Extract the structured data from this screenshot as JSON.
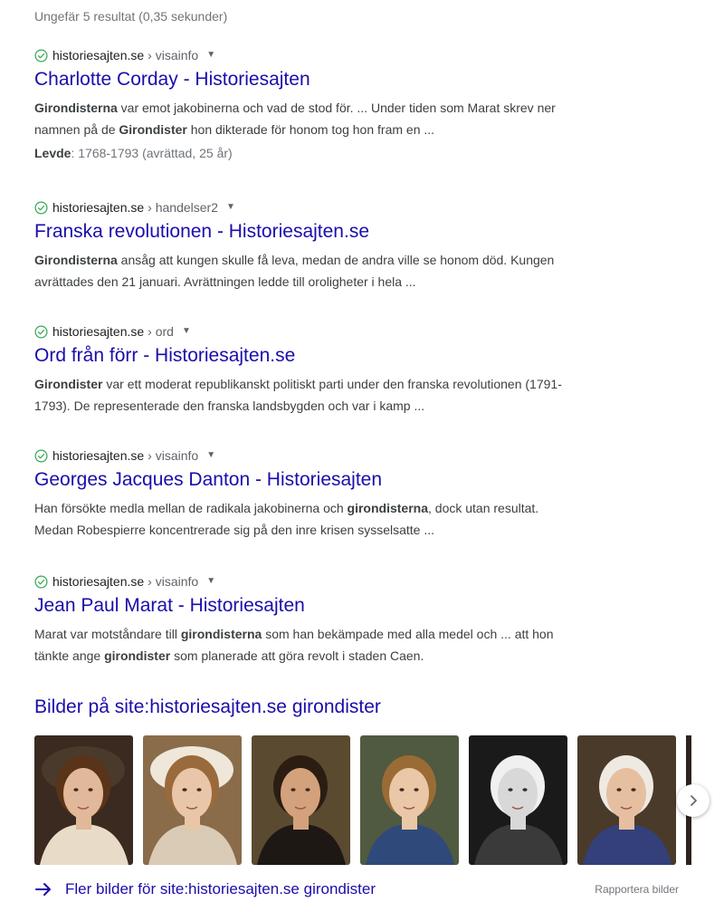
{
  "stats": "Ungefär 5 resultat (0,35 sekunder)",
  "results": [
    {
      "domain": "historiesajten.se",
      "path": "› visainfo",
      "title": "Charlotte Corday - Historiesajten",
      "snippet": [
        [
          {
            "b": "Girondisterna"
          },
          {
            "t": " var emot jakobinerna och vad de stod för. ... Under tiden som Marat skrev ner"
          }
        ],
        [
          {
            "t": "namnen på de "
          },
          {
            "b": "Girondister"
          },
          {
            "t": " hon dikterade för honom tog hon fram en ..."
          }
        ]
      ],
      "extra_label": "Levde",
      "extra_value": ": 1768-1793 (avrättad, 25 år)"
    },
    {
      "domain": "historiesajten.se",
      "path": "› handelser2",
      "title": "Franska revolutionen - Historiesajten.se",
      "snippet": [
        [
          {
            "b": "Girondisterna"
          },
          {
            "t": " ansåg att kungen skulle få leva, medan de andra ville se honom död. Kungen"
          }
        ],
        [
          {
            "t": "avrättades den 21 januari. Avrättningen ledde till oroligheter i hela ..."
          }
        ]
      ]
    },
    {
      "domain": "historiesajten.se",
      "path": "› ord",
      "title": "Ord från förr - Historiesajten.se",
      "snippet": [
        [
          {
            "b": "Girondister"
          },
          {
            "t": " var ett moderat republikanskt politiskt parti under den franska revolutionen (1791-"
          }
        ],
        [
          {
            "t": "1793). De representerade den franska landsbygden och var i kamp ..."
          }
        ]
      ]
    },
    {
      "domain": "historiesajten.se",
      "path": "› visainfo",
      "title": "Georges Jacques Danton - Historiesajten",
      "snippet": [
        [
          {
            "t": "Han försökte medla mellan de radikala jakobinerna och "
          },
          {
            "b": "girondisterna"
          },
          {
            "t": ", dock utan resultat."
          }
        ],
        [
          {
            "t": "Medan Robespierre koncentrerade sig på den inre krisen sysselsatte ..."
          }
        ]
      ]
    },
    {
      "domain": "historiesajten.se",
      "path": "› visainfo",
      "title": "Jean Paul Marat - Historiesajten",
      "snippet": [
        [
          {
            "t": "Marat var motståndare till "
          },
          {
            "b": "girondisterna"
          },
          {
            "t": " som han bekämpade med alla medel och ... att hon"
          }
        ],
        [
          {
            "t": "tänkte ange "
          },
          {
            "b": "girondister"
          },
          {
            "t": " som planerade att göra revolt i staden Caen."
          }
        ]
      ]
    }
  ],
  "images": {
    "heading": "Bilder på site:historiesajten.se girondister",
    "thumbnails": [
      {
        "name": "portrait-woman-bonnet",
        "bg": "#3b2a1f",
        "skin": "#e2b89a",
        "hair": "#5a3418",
        "cloth": "#e8dcc8",
        "hat": "#4a3a2c"
      },
      {
        "name": "portrait-woman-white-cap",
        "bg": "#8a6c4a",
        "skin": "#e9c6a8",
        "hair": "#9a6a3c",
        "cloth": "#d9cbb5",
        "hat": "#efe7da"
      },
      {
        "name": "portrait-man-dark-coat",
        "bg": "#5a4a30",
        "skin": "#d3a27c",
        "hair": "#2b1d12",
        "cloth": "#1e1814",
        "hat": ""
      },
      {
        "name": "portrait-boy-blue-coat",
        "bg": "#4f5a40",
        "skin": "#eac7a7",
        "hair": "#9b6b35",
        "cloth": "#2f4a7a",
        "hat": ""
      },
      {
        "name": "portrait-man-white-wig-bw",
        "bg": "#1a1a1a",
        "skin": "#d8d8d8",
        "hair": "#f0f0f0",
        "cloth": "#3a3a3a",
        "hat": ""
      },
      {
        "name": "portrait-king-louis-xvi",
        "bg": "#4a3a2a",
        "skin": "#e6bfa0",
        "hair": "#eeeae2",
        "cloth": "#33407a",
        "hat": ""
      }
    ],
    "more_link": "Fler bilder för site:historiesajten.se girondister",
    "report": "Rapportera bilder"
  },
  "colors": {
    "link": "#1a0dab",
    "verified_check": "#34a853"
  }
}
